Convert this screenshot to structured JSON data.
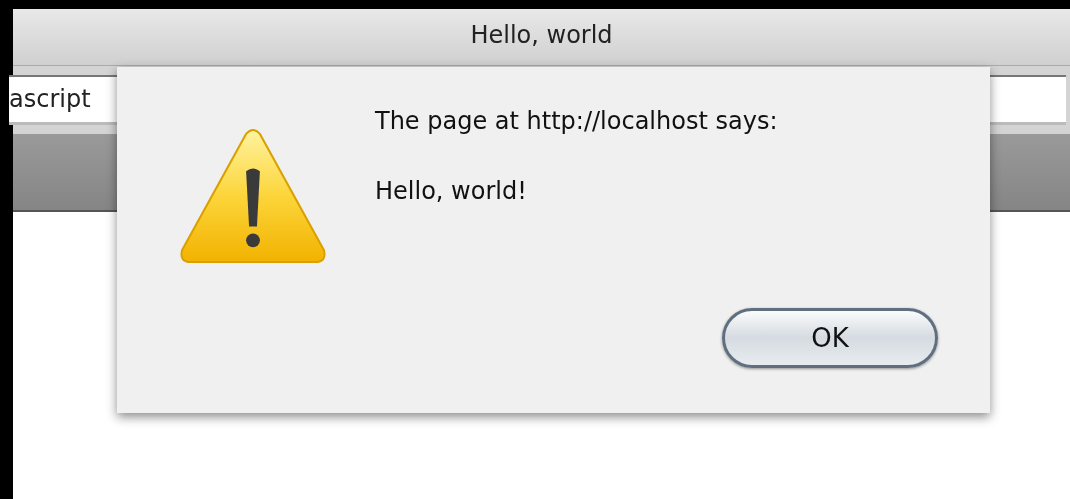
{
  "window": {
    "title": "Hello, world"
  },
  "address_bar": {
    "value": "ascript"
  },
  "alert": {
    "heading": "The page at http://localhost says:",
    "message": "Hello, world!",
    "buttons": [
      {
        "label": "OK",
        "default": true
      }
    ]
  }
}
